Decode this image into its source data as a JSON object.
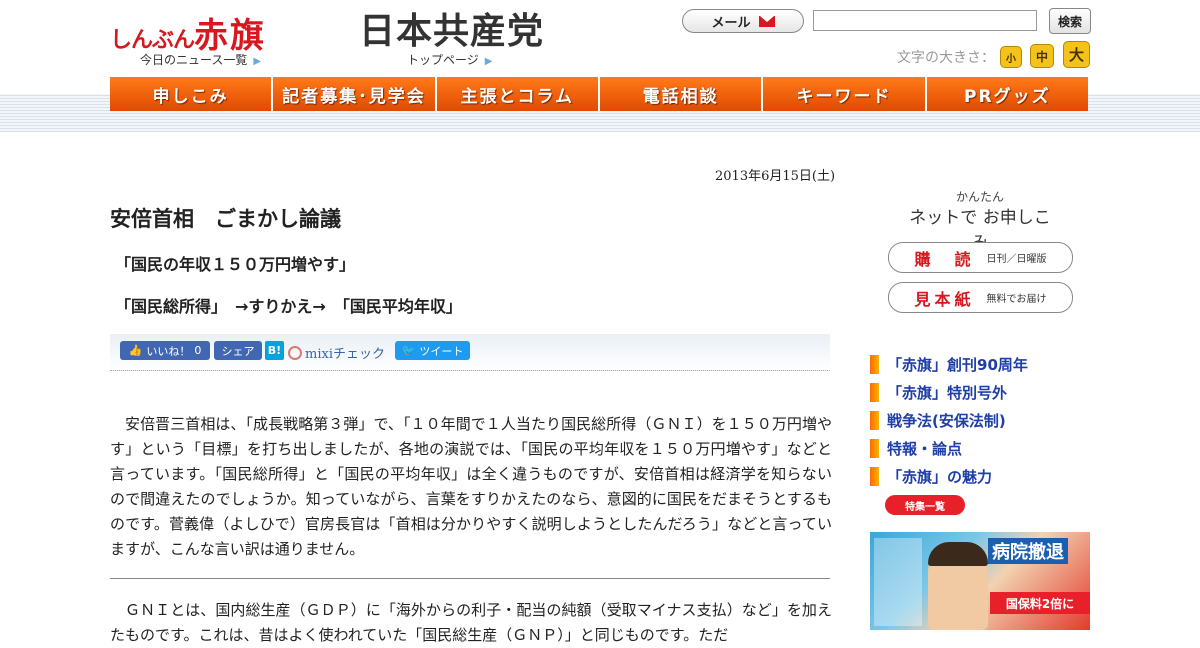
{
  "header": {
    "akahata_logo_small": "しんぶん",
    "akahata_logo_big": "赤旗",
    "news_list_link": "今日のニュース一覧",
    "jcp_logo": "日本共産党",
    "top_page_link": "トップページ",
    "mail_label": "メール",
    "search_value": "",
    "search_button": "検索",
    "font_size_label": "文字の大きさ：",
    "font_sizes": [
      "小",
      "中",
      "大"
    ]
  },
  "nav": {
    "items": [
      "申しこみ",
      "記者募集･見学会",
      "主張とコラム",
      "電話相談",
      "キーワード",
      "PRグッズ"
    ]
  },
  "article": {
    "date": "2013年6月15日(土)",
    "title": "安倍首相　ごまかし論議",
    "subtitle1": "「国民の年収１５０万円増やす」",
    "subtitle2": "「国民総所得」　→すりかえ→　「国民平均年収」",
    "paragraph1": "　安倍晋三首相は、「成長戦略第３弾」で、「１０年間で１人当たり国民総所得（ＧＮＩ）を１５０万円増やす」という「目標」を打ち出しましたが、各地の演説では、「国民の平均年収を１５０万円増やす」などと言っています。「国民総所得」と「国民の平均年収」は全く違うものですが、安倍首相は経済学を知らないので間違えたのでしょうか。知っていながら、言葉をすりかえたのなら、意図的に国民をだまそうとするものです。菅義偉（よしひで）官房長官は「首相は分かりやすく説明しようとしたんだろう」などと言っていますが、こんな言い訳は通りません。",
    "paragraph2": "　ＧＮＩとは、国内総生産（ＧＤＰ）に「海外からの利子・配当の純額（受取マイナス支払）など」を加えたものです。これは、昔はよく使われていた「国民総生産（ＧＮＰ）」と同じものです。ただ"
  },
  "share": {
    "like_label": "いいね！",
    "like_count": "0",
    "share_label": "シェア",
    "hatena_label": "B!",
    "mixi_label": "mixiチェック",
    "tweet_label": "ツイート"
  },
  "sidebar": {
    "kantan": "かんたん",
    "net_apply": "ネットで お申しこみ",
    "subscribe_main": "購　読",
    "subscribe_note": "日刊／日曜版",
    "sample_main": "見本紙",
    "sample_note": "無料でお届け",
    "links": [
      "「赤旗」創刊90周年",
      "「赤旗」特別号外",
      "戦争法(安保法制)",
      "特報・論点",
      "「赤旗」の魅力"
    ],
    "tokushu_button": "特集一覧",
    "magazine_headline": "病院撤退",
    "magazine_band": "国保料2倍に"
  }
}
